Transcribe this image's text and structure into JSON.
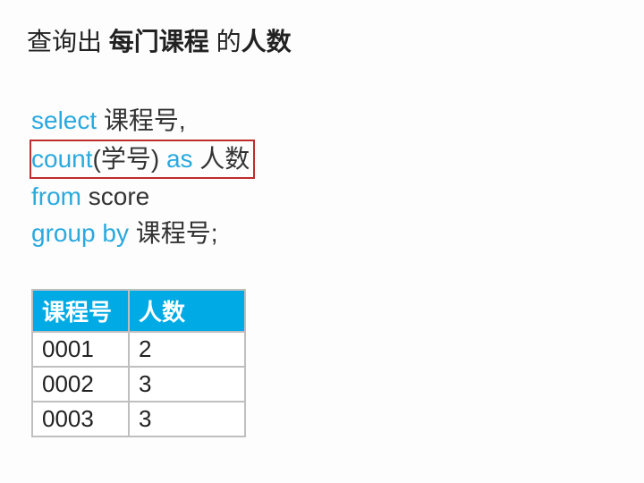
{
  "title": {
    "part1": "查询出 ",
    "bold1": "每门课程",
    "part2": " 的",
    "bold2": "人数"
  },
  "sql": {
    "line1_kw": "select",
    "line1_txt": " 课程号,",
    "line2_kw1": "count",
    "line2_txt1": "(学号) ",
    "line2_kw2": "as",
    "line2_txt2": " 人数",
    "line3_kw": "from",
    "line3_txt": " score",
    "line4_kw": "group by",
    "line4_txt": " 课程号;"
  },
  "chart_data": {
    "type": "table",
    "headers": [
      "课程号",
      "人数"
    ],
    "rows": [
      [
        "0001",
        "2"
      ],
      [
        "0002",
        "3"
      ],
      [
        "0003",
        "3"
      ]
    ]
  }
}
